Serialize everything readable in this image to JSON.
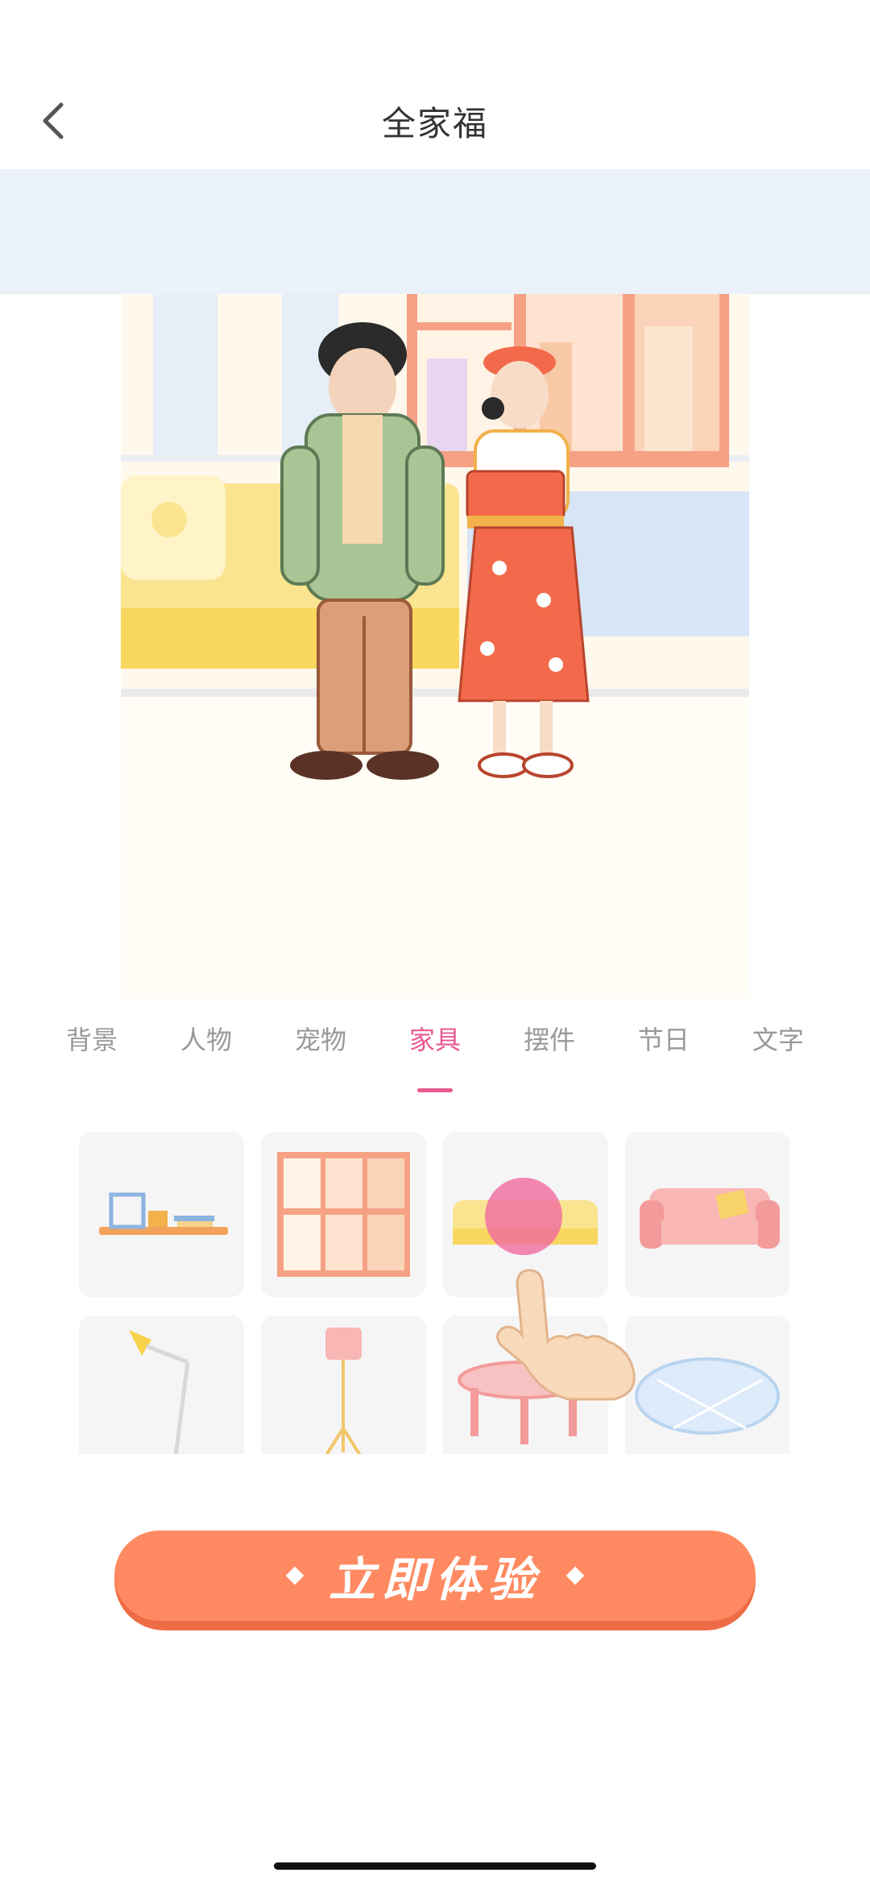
{
  "header": {
    "title": "全家福",
    "back_icon": "chevron-left-icon"
  },
  "canvas": {
    "scene": "illustrated-living-room-with-couple"
  },
  "tabs": [
    {
      "label": "背景",
      "active": false
    },
    {
      "label": "人物",
      "active": false
    },
    {
      "label": "宠物",
      "active": false
    },
    {
      "label": "家具",
      "active": true
    },
    {
      "label": "摆件",
      "active": false
    },
    {
      "label": "节日",
      "active": false
    },
    {
      "label": "文字",
      "active": false
    }
  ],
  "furniture_items": [
    {
      "icon": "shelf-icon"
    },
    {
      "icon": "window-icon"
    },
    {
      "icon": "yellow-sofa-icon"
    },
    {
      "icon": "pink-sofa-icon"
    },
    {
      "icon": "desk-lamp-icon"
    },
    {
      "icon": "floor-lamp-icon"
    },
    {
      "icon": "round-table-icon"
    },
    {
      "icon": "round-rug-icon"
    }
  ],
  "hint": {
    "icon": "tap-hand-icon"
  },
  "cta": {
    "label": "立即体验"
  },
  "colors": {
    "accent_pink": "#e9588f",
    "cta_orange": "#ff8a61",
    "banner_blue": "#eaf1f9"
  }
}
